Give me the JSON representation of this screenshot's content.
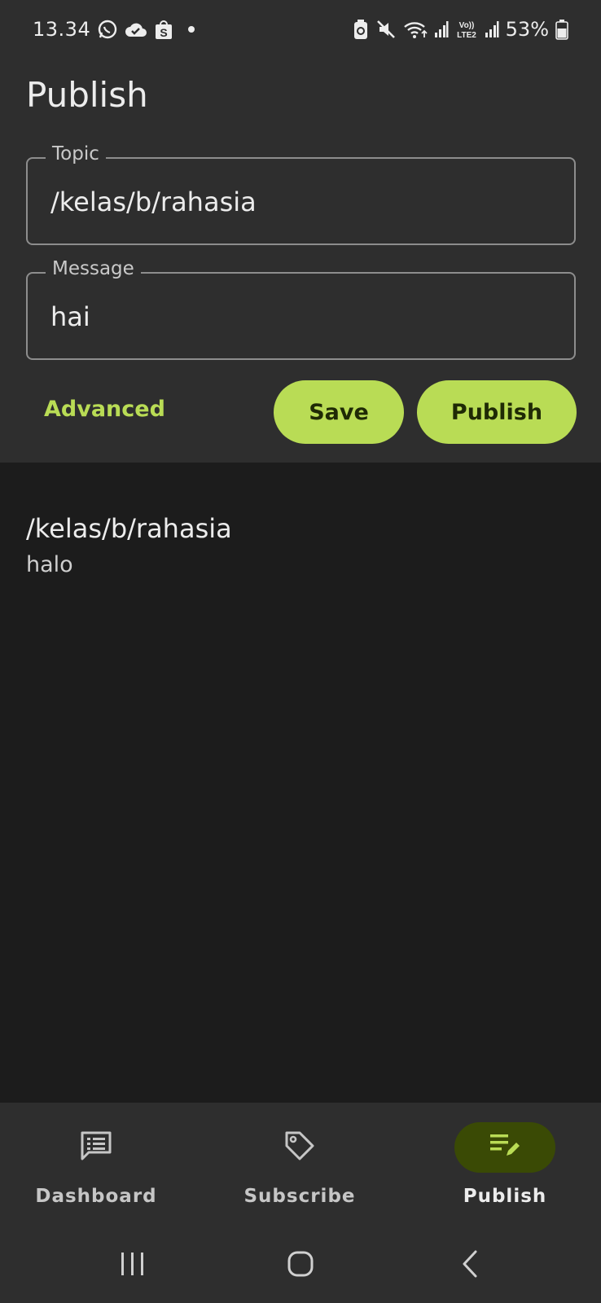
{
  "status_bar": {
    "time": "13.34",
    "battery": "53%",
    "icons": [
      "whatsapp-icon",
      "cloud-check-icon",
      "shopee-icon",
      "dot-icon",
      "battery-saver-icon",
      "mute-icon",
      "wifi-icon",
      "signal-icon",
      "volte-lte2-icon",
      "signal-icon",
      "battery-icon"
    ],
    "volte_label": "Vo)) LTE2"
  },
  "page": {
    "title": "Publish"
  },
  "form": {
    "topic_label": "Topic",
    "topic_value": "/kelas/b/rahasia",
    "message_label": "Message",
    "message_value": "hai"
  },
  "actions": {
    "advanced_label": "Advanced",
    "save_label": "Save",
    "publish_label": "Publish"
  },
  "messages": [
    {
      "topic": "/kelas/b/rahasia",
      "body": "halo"
    }
  ],
  "bottom_nav": {
    "items": [
      {
        "label": "Dashboard",
        "icon": "dashboard-icon",
        "active": false
      },
      {
        "label": "Subscribe",
        "icon": "tag-icon",
        "active": false
      },
      {
        "label": "Publish",
        "icon": "publish-edit-icon",
        "active": true
      }
    ]
  },
  "system_nav": {
    "icons": [
      "recents-icon",
      "home-icon",
      "back-icon"
    ]
  },
  "colors": {
    "accent": "#b9dc55",
    "panel_bg": "#2e2e2e",
    "list_bg": "#1c1c1c",
    "active_nav_pill": "#3a4a05"
  }
}
